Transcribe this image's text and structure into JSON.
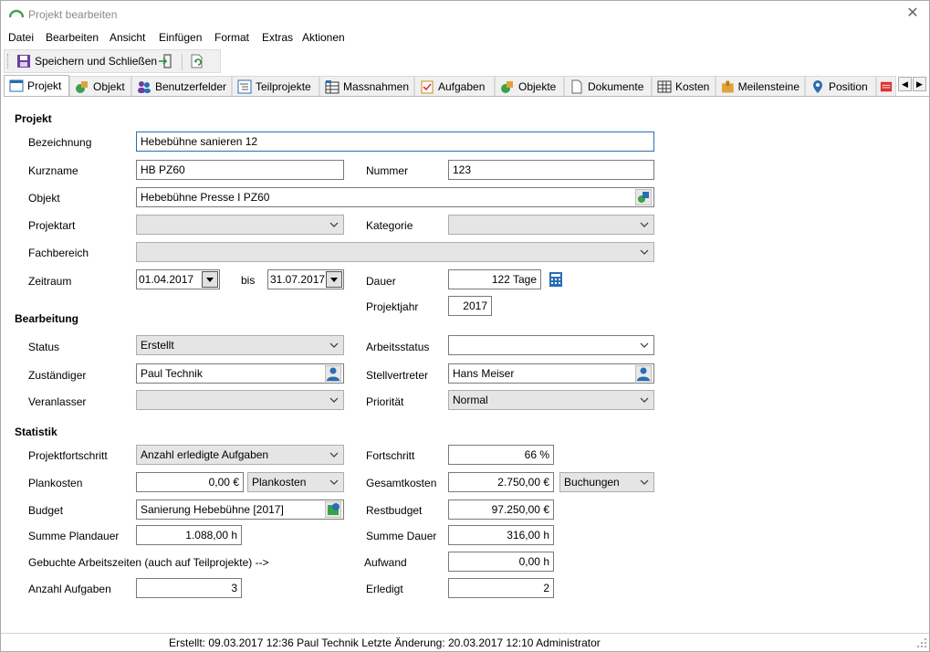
{
  "window": {
    "title": "Projekt bearbeiten",
    "close_symbol": "✕"
  },
  "menu": [
    "Datei",
    "Bearbeiten",
    "Ansicht",
    "Einfügen",
    "Format",
    "Extras",
    "Aktionen"
  ],
  "toolbar": {
    "save_close_label": "Speichern und Schließen"
  },
  "tabs": [
    {
      "label": "Projekt",
      "icon": "project-icon",
      "active": true
    },
    {
      "label": "Objekt",
      "icon": "object-icon"
    },
    {
      "label": "Benutzerfelder",
      "icon": "users-icon"
    },
    {
      "label": "Teilprojekte",
      "icon": "subprojects-icon"
    },
    {
      "label": "Massnahmen",
      "icon": "measures-icon"
    },
    {
      "label": "Aufgaben",
      "icon": "tasks-icon"
    },
    {
      "label": "Objekte",
      "icon": "objects-icon"
    },
    {
      "label": "Dokumente",
      "icon": "document-icon"
    },
    {
      "label": "Kosten",
      "icon": "cost-icon"
    },
    {
      "label": "Meilensteine",
      "icon": "milestone-icon"
    },
    {
      "label": "Position",
      "icon": "location-pin-icon"
    }
  ],
  "sections": {
    "projekt": "Projekt",
    "bearbeitung": "Bearbeitung",
    "statistik": "Statistik"
  },
  "projekt": {
    "bezeichnung_label": "Bezeichnung",
    "bezeichnung": "Hebebühne sanieren 12",
    "kurzname_label": "Kurzname",
    "kurzname": "HB PZ60",
    "nummer_label": "Nummer",
    "nummer": "123",
    "objekt_label": "Objekt",
    "objekt": "Hebebühne Presse I PZ60",
    "projektart_label": "Projektart",
    "projektart": "",
    "kategorie_label": "Kategorie",
    "kategorie": "",
    "fachbereich_label": "Fachbereich",
    "fachbereich": "",
    "zeitraum_label": "Zeitraum",
    "von": "01.04.2017",
    "bis_label": "bis",
    "bis": "31.07.2017",
    "dauer_label": "Dauer",
    "dauer": "122 Tage",
    "projektjahr_label": "Projektjahr",
    "projektjahr": "2017"
  },
  "bearbeitung": {
    "status_label": "Status",
    "status": "Erstellt",
    "arbeitsstatus_label": "Arbeitsstatus",
    "arbeitsstatus": "",
    "zustaendiger_label": "Zuständiger",
    "zustaendiger": "Paul Technik",
    "stellvertreter_label": "Stellvertreter",
    "stellvertreter": "Hans Meiser",
    "veranlasser_label": "Veranlasser",
    "veranlasser": "",
    "prioritaet_label": "Priorität",
    "prioritaet": "Normal"
  },
  "statistik": {
    "projektfortschritt_label": "Projektfortschritt",
    "projektfortschritt": "Anzahl erledigte Aufgaben",
    "fortschritt_label": "Fortschritt",
    "fortschritt": "66 %",
    "plankosten_label": "Plankosten",
    "plankosten": "0,00 €",
    "plankosten_mode": "Plankosten",
    "gesamtkosten_label": "Gesamtkosten",
    "gesamtkosten": "2.750,00 €",
    "gesamtkosten_mode": "Buchungen",
    "budget_label": "Budget",
    "budget": "Sanierung Hebebühne [2017]",
    "restbudget_label": "Restbudget",
    "restbudget": "97.250,00 €",
    "summe_plandauer_label": "Summe Plandauer",
    "summe_plandauer": "1.088,00 h",
    "summe_dauer_label": "Summe Dauer",
    "summe_dauer": "316,00 h",
    "gebuchte_label": "Gebuchte Arbeitszeiten (auch auf Teilprojekte) -->",
    "aufwand_label": "Aufwand",
    "aufwand": "0,00 h",
    "anzahl_aufgaben_label": "Anzahl Aufgaben",
    "anzahl_aufgaben": "3",
    "erledigt_label": "Erledigt",
    "erledigt": "2"
  },
  "statusbar": {
    "text": "Erstellt: 09.03.2017 12:36 Paul Technik  Letzte Änderung: 20.03.2017 12:10 Administrator"
  },
  "colors": {
    "focus_border": "#2c6fb0",
    "combo_bg": "#e5e5e5",
    "title_text": "#8a8a8a"
  }
}
